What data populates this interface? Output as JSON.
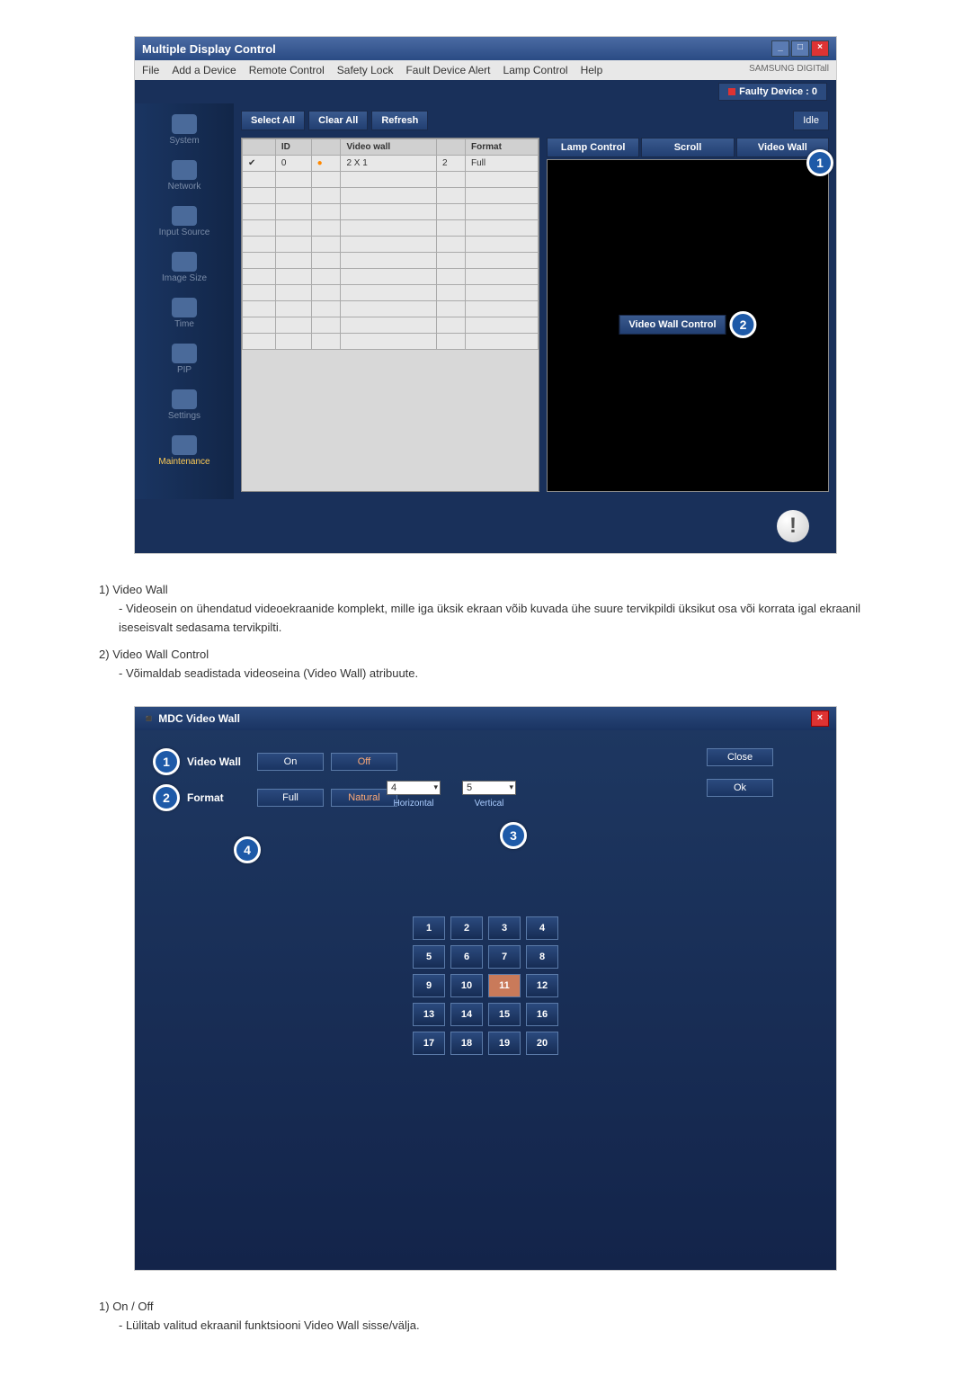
{
  "mdc": {
    "title": "Multiple Display Control",
    "menu": [
      "File",
      "Add a Device",
      "Remote Control",
      "Safety Lock",
      "Fault Device Alert",
      "Lamp Control",
      "Help"
    ],
    "menu_brand": "SAMSUNG DIGITall",
    "faulty_label": "Faulty Device : 0",
    "sidebar": [
      {
        "label": "System"
      },
      {
        "label": "Network"
      },
      {
        "label": "Input Source"
      },
      {
        "label": "Image Size"
      },
      {
        "label": "Time"
      },
      {
        "label": "PIP"
      },
      {
        "label": "Settings"
      },
      {
        "label": "Maintenance"
      }
    ],
    "active_sidebar": "Maintenance",
    "toolbar": {
      "select_all": "Select All",
      "clear_all": "Clear All",
      "refresh": "Refresh",
      "idle": "Idle"
    },
    "table": {
      "headers": [
        "",
        "ID",
        "",
        "Video wall",
        "",
        "Format"
      ],
      "rows": [
        [
          "✔",
          "0",
          "●",
          "2 X 1",
          "2",
          "Full"
        ],
        [
          "",
          "",
          "",
          "",
          "",
          ""
        ],
        [
          "",
          "",
          "",
          "",
          "",
          ""
        ],
        [
          "",
          "",
          "",
          "",
          "",
          ""
        ],
        [
          "",
          "",
          "",
          "",
          "",
          ""
        ],
        [
          "",
          "",
          "",
          "",
          "",
          ""
        ],
        [
          "",
          "",
          "",
          "",
          "",
          ""
        ],
        [
          "",
          "",
          "",
          "",
          "",
          ""
        ],
        [
          "",
          "",
          "",
          "",
          "",
          ""
        ],
        [
          "",
          "",
          "",
          "",
          "",
          ""
        ],
        [
          "",
          "",
          "",
          "",
          "",
          ""
        ],
        [
          "",
          "",
          "",
          "",
          "",
          ""
        ]
      ]
    },
    "preview_tabs": [
      "Lamp Control",
      "Scroll",
      "Video Wall"
    ],
    "video_wall_control_label": "Video Wall Control"
  },
  "desc1": [
    {
      "num": "1)",
      "title": "Video Wall",
      "sub": "- Videosein on ühendatud videoekraanide komplekt, mille iga üksik ekraan võib kuvada ühe suure tervikpildi üksikut osa või korrata igal ekraanil iseseisvalt sedasama tervikpilti."
    },
    {
      "num": "2)",
      "title": "Video Wall Control",
      "sub": "- Võimaldab seadistada videoseina (Video Wall) atribuute."
    }
  ],
  "vwall": {
    "title": "MDC Video Wall",
    "label_video_wall": "Video Wall",
    "label_format": "Format",
    "btn_on": "On",
    "btn_off": "Off",
    "btn_full": "Full",
    "btn_natural": "Natural",
    "btn_close": "Close",
    "btn_ok": "Ok",
    "horizontal": "4",
    "vertical": "5",
    "lbl_horizontal": "Horizontal",
    "lbl_vertical": "Vertical",
    "grid_selected": 11
  },
  "desc2": [
    {
      "num": "1)",
      "title": "On / Off",
      "sub": "- Lülitab valitud ekraanil funktsiooni Video Wall sisse/välja."
    }
  ]
}
